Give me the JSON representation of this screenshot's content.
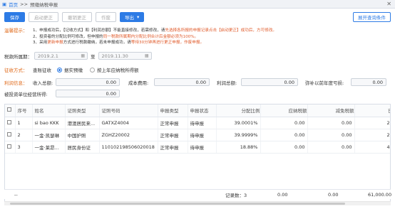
{
  "titlebar": {
    "home": "首页",
    "sep": ">>",
    "crumb": "预缴纳税申报",
    "close": "✕"
  },
  "toolbar": {
    "save": "保存",
    "start_correction": "启动更正",
    "cancel_correction": "撤销更正",
    "void": "作废",
    "export": "导出",
    "expand": "展开查询条件"
  },
  "notes": {
    "label": "温馨提示：",
    "line1_a": "1、申报成功后，【记收方式】和【利润总额】不能直接修改，若需修改，请",
    "line1_b": "先选择各所报的申报记录点击【启动更正】成功后，方可修改。",
    "line2_a": "2、投资者的分配比例可修改，但申报的",
    "line2_b": "同一税款所属期内分配比例合计后金额必须为100%。",
    "line3_a": "3、采用",
    "line3_b": "更新申报",
    "line3_c": "方式进行税款缴纳，若未申报成功，请",
    "line3_d": "等待30分钟再进行更正申报，作废申报。"
  },
  "period": {
    "label": "税款所属期：",
    "start": "2019.2.1",
    "to": "至",
    "end": "2019.11.30"
  },
  "levy": {
    "label": "征收方式：",
    "value": "查账征收",
    "opt1": "据实预缴",
    "opt2": "按上年应纳税所得额"
  },
  "profit": {
    "label": "利润信息：",
    "income_label": "收入总额:",
    "income": "0.00",
    "cost_label": "成本费用:",
    "cost": "0.00",
    "profit_label": "利润总额:",
    "profit": "0.00",
    "loss_label": "弥补以前年度亏损:",
    "loss": "0.00"
  },
  "invested": {
    "label": "被投资单位经营所得:",
    "value": "0.00"
  },
  "table": {
    "headers": [
      "序号",
      "姓名",
      "证照类型",
      "证照号码",
      "申报类型",
      "申报状态",
      "分配比例",
      "应纳税额",
      "减免税额",
      "已预缴税额"
    ],
    "rows": [
      {
        "no": "1",
        "name": "si bao KKK",
        "idtype": "港澳居民来...",
        "idno": "GATXZ4004",
        "dtype": "正常申报",
        "status": "待申报",
        "ratio": "39.0001%",
        "tax": "0.00",
        "relief": "0.00",
        "paid": "20500.00"
      },
      {
        "no": "2",
        "name": "一金·凯瑟琳",
        "idtype": "中国护照",
        "idno": "ZGHZ20002",
        "dtype": "正常申报",
        "status": "待申报",
        "ratio": "39.9999%",
        "tax": "0.00",
        "relief": "0.00",
        "paid": "20500.00"
      },
      {
        "no": "3",
        "name": "一金·莱昂...",
        "idtype": "居民身份证",
        "idno": "110102198506020018",
        "dtype": "正常申报",
        "status": "待申报",
        "ratio": "18.88%",
        "tax": "0.00",
        "relief": "0.00",
        "paid": "40500.00"
      }
    ]
  },
  "footer": {
    "dash": "--",
    "records": "记录数：3",
    "tax": "0.00",
    "relief": "0.00",
    "paid": "61,000.00"
  }
}
